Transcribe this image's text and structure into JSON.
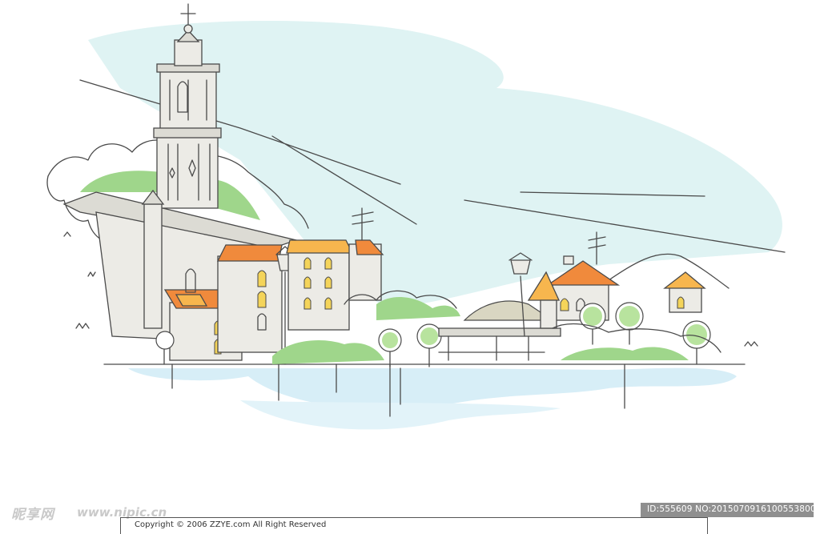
{
  "illustration": {
    "subject": "hand-drawn harbour town with bell tower",
    "palette": {
      "sky": "#dff3f3",
      "water": "#d7eef7",
      "roof": "#f08a3c",
      "roof_light": "#f7b64e",
      "wall": "#e9e7e2",
      "greenery": "#9fd68b",
      "line": "#4a4a4a",
      "window": "#f4d45a"
    }
  },
  "watermark": {
    "logo": "昵享网",
    "url": "www.nipic.cn",
    "id_text": "ID:555609 NO:20150709161005538000",
    "copyright": "Copyright © 2006 ZZYE.com  All Right Reserved"
  }
}
